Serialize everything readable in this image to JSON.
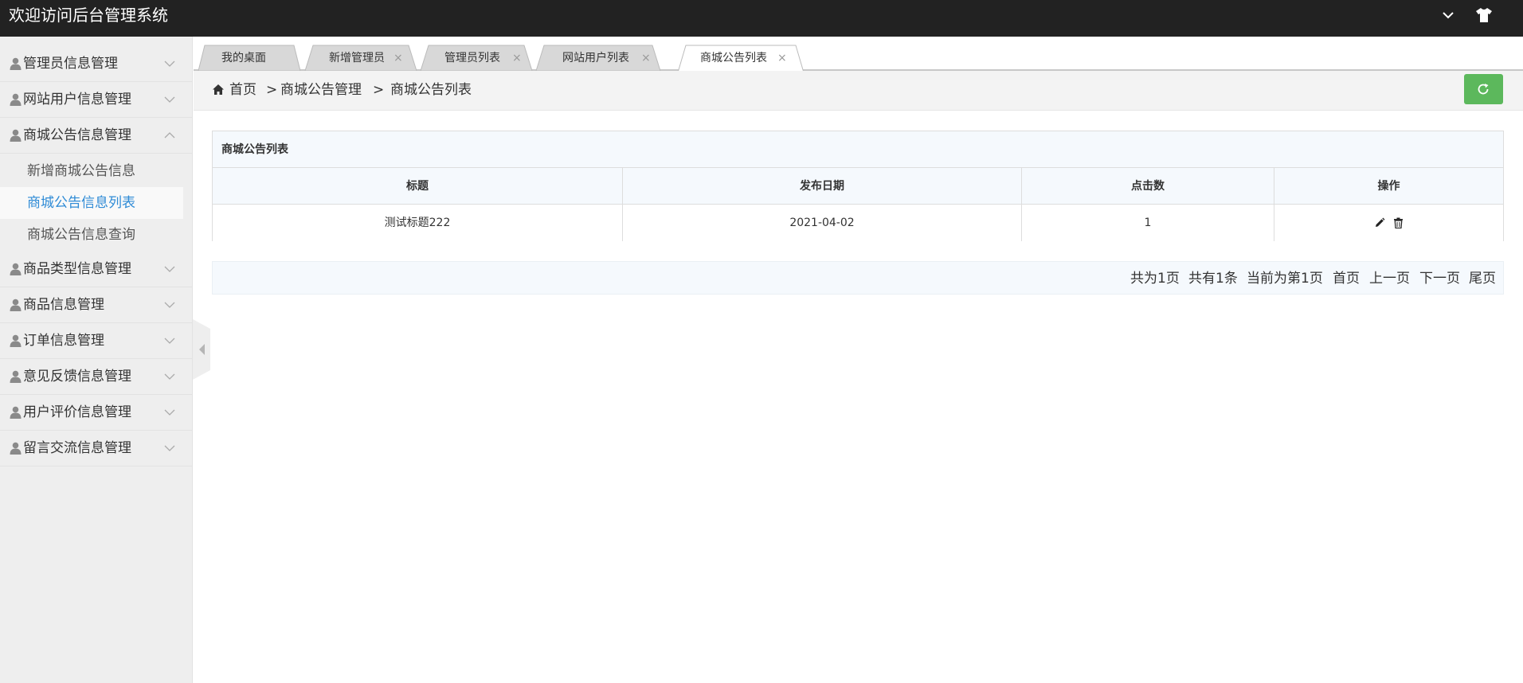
{
  "app": {
    "title": "欢迎访问后台管理系统"
  },
  "sidebar": {
    "menus": [
      {
        "label": "管理员信息管理",
        "expanded": false
      },
      {
        "label": "网站用户信息管理",
        "expanded": false
      },
      {
        "label": "商城公告信息管理",
        "expanded": true
      },
      {
        "label": "商品类型信息管理",
        "expanded": false
      },
      {
        "label": "商品信息管理",
        "expanded": false
      },
      {
        "label": "订单信息管理",
        "expanded": false
      },
      {
        "label": "意见反馈信息管理",
        "expanded": false
      },
      {
        "label": "用户评价信息管理",
        "expanded": false
      },
      {
        "label": "留言交流信息管理",
        "expanded": false
      }
    ],
    "submenu": [
      {
        "label": "新增商城公告信息"
      },
      {
        "label": "商城公告信息列表",
        "active": true
      },
      {
        "label": "商城公告信息查询"
      }
    ]
  },
  "tabs": [
    {
      "label": "我的桌面",
      "closable": false
    },
    {
      "label": "新增管理员",
      "closable": true
    },
    {
      "label": "管理员列表",
      "closable": true
    },
    {
      "label": "网站用户列表",
      "closable": true
    },
    {
      "label": "商城公告列表",
      "closable": true,
      "active": true
    }
  ],
  "tab_close_glyph": "×",
  "breadcrumb": {
    "home": "首页",
    "separator": ">",
    "level1": "商城公告管理",
    "level2": "商城公告列表"
  },
  "table": {
    "caption": "商城公告列表",
    "headers": [
      "标题",
      "发布日期",
      "点击数",
      "操作"
    ],
    "rows": [
      {
        "title": "测试标题222",
        "date": "2021-04-02",
        "clicks": "1"
      }
    ]
  },
  "pagination": {
    "total_pages": "共为1页",
    "total_records": "共有1条",
    "current": "当前为第1页",
    "first": "首页",
    "prev": "上一页",
    "next": "下一页",
    "last": "尾页"
  },
  "colors": {
    "topbar": "#222222",
    "sidebar": "#eeeeee",
    "accent": "#2f8bd6",
    "refresh": "#5cb85c",
    "table_header": "#f5f9fd"
  },
  "icons": [
    "user-icon",
    "chevron-down-icon",
    "chevron-up-icon",
    "shirt-icon",
    "home-icon",
    "refresh-icon",
    "edit-icon",
    "trash-icon",
    "collapse-left-icon",
    "close-icon"
  ]
}
